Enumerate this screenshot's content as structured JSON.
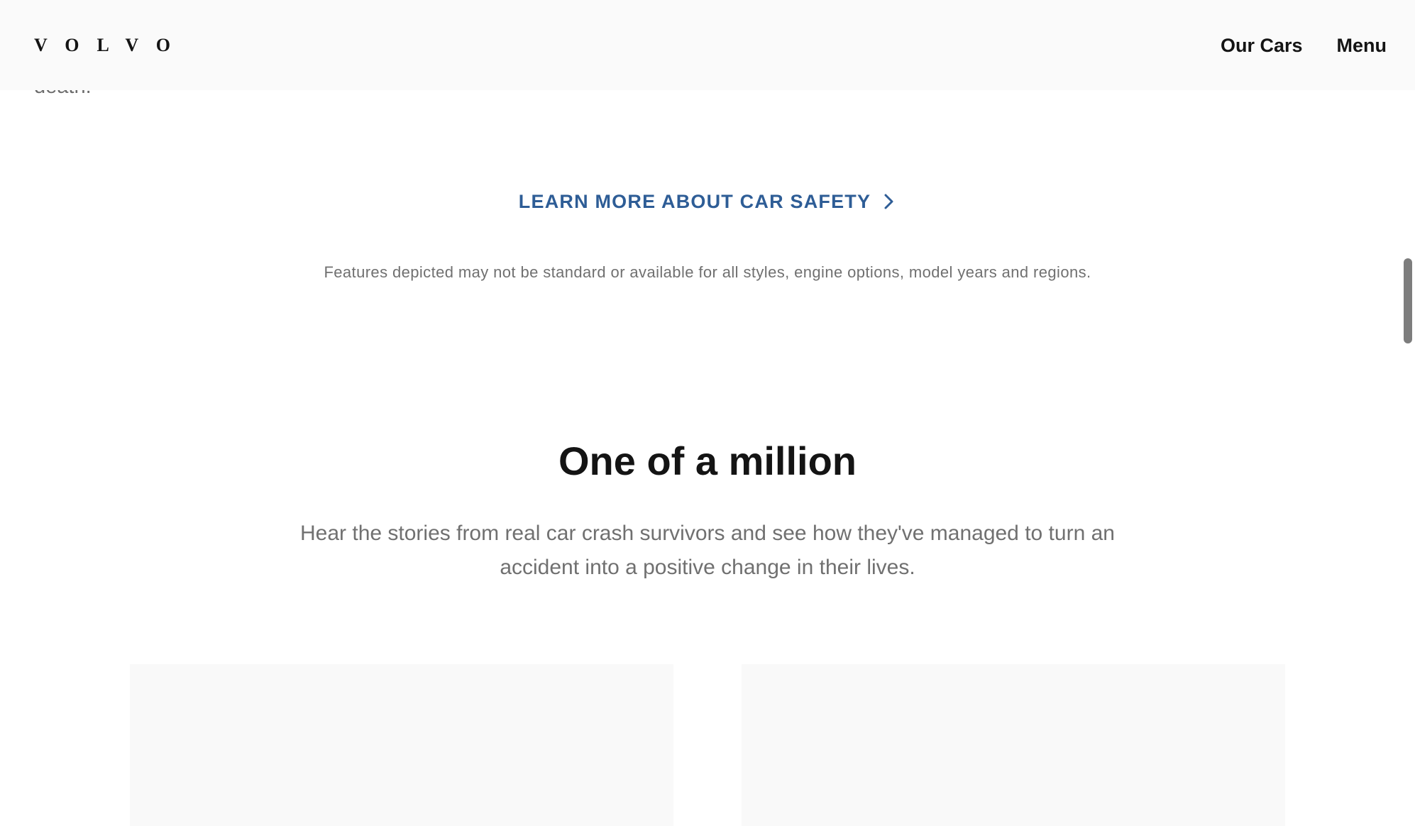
{
  "header": {
    "logo_text": "VOLVO",
    "nav": {
      "our_cars": "Our Cars",
      "menu": "Menu"
    }
  },
  "main": {
    "cutoff_text": "death.",
    "cta": {
      "label": "LEARN MORE ABOUT CAR SAFETY",
      "icon": "chevron-right-icon",
      "color": "#2e5d96"
    },
    "disclaimer": "Features depicted may not be standard or available for all styles, engine options, model years and regions.",
    "section": {
      "title": "One of a million",
      "description": "Hear the stories from real car crash survivors and see how they've managed to turn an accident into a positive change in their lives."
    }
  }
}
